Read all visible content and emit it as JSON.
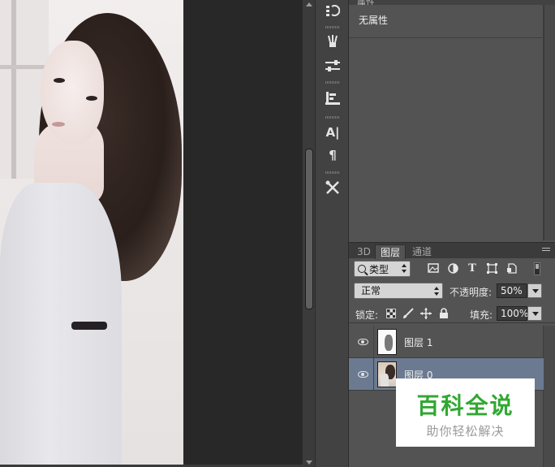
{
  "properties_panel": {
    "tab_label": "属性",
    "empty_label": "无属性"
  },
  "layers_panel": {
    "tabs": [
      {
        "label": "3D"
      },
      {
        "label": "图层"
      },
      {
        "label": "通道"
      }
    ],
    "filter_label": "类型",
    "filter_icons": [
      "image-icon",
      "adjustment-icon",
      "type-icon",
      "shape-icon",
      "smart-object-icon"
    ],
    "blend_mode": "正常",
    "opacity_label": "不透明度:",
    "opacity_value": "50%",
    "lock_label": "锁定:",
    "lock_icons": [
      "lock-transparency-icon",
      "lock-paint-icon",
      "lock-position-icon",
      "lock-all-icon"
    ],
    "fill_label": "填充:",
    "fill_value": "100%",
    "layers": [
      {
        "name": "图层 1",
        "visible": true,
        "selected": false
      },
      {
        "name": "图层 0",
        "visible": true,
        "selected": true
      }
    ]
  },
  "tool_strip": {
    "icons": [
      "history-icon",
      "brush-preset-icon",
      "adjustments-icon",
      "clone-source-icon",
      "character-icon",
      "paragraph-icon",
      "tool-preset-icon"
    ]
  },
  "watermark": {
    "title": "百科全说",
    "subtitle": "助你轻松解决"
  },
  "colors": {
    "panel_bg": "#535353",
    "canvas_gap": "#282828",
    "selected_layer": "#6b7a90",
    "watermark_green": "#31a831"
  }
}
